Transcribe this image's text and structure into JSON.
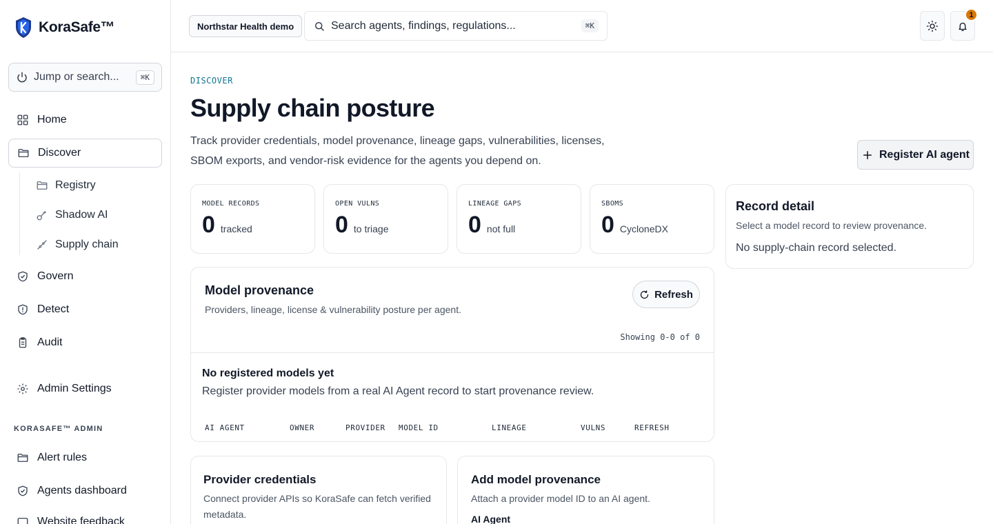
{
  "brand": {
    "name": "KoraSafe™"
  },
  "sidebar": {
    "jump_placeholder": "Jump or search...",
    "jump_shortcut": "⌘K",
    "items": [
      {
        "label": "Home"
      },
      {
        "label": "Discover"
      },
      {
        "label": "Govern"
      },
      {
        "label": "Detect"
      },
      {
        "label": "Audit"
      },
      {
        "label": "Admin Settings"
      }
    ],
    "sub_items": [
      {
        "label": "Registry"
      },
      {
        "label": "Shadow AI"
      },
      {
        "label": "Supply chain"
      }
    ],
    "admin_section": "KORASAFE™ ADMIN",
    "admin_items": [
      {
        "label": "Alert rules"
      },
      {
        "label": "Agents dashboard"
      },
      {
        "label": "Website feedback"
      }
    ]
  },
  "topbar": {
    "org": "Northstar Health demo",
    "search_placeholder": "Search agents, findings, regulations...",
    "search_shortcut": "⌘K",
    "notification_count": "1"
  },
  "page": {
    "eyebrow": "DISCOVER",
    "title": "Supply chain posture",
    "description": "Track provider credentials, model provenance, lineage gaps, vulnerabilities, licenses, SBOM exports, and vendor-risk evidence for the agents you depend on.",
    "primary_action": "Register AI agent"
  },
  "stats": [
    {
      "label": "MODEL RECORDS",
      "value": "0",
      "unit": "tracked"
    },
    {
      "label": "OPEN VULNS",
      "value": "0",
      "unit": "to triage"
    },
    {
      "label": "LINEAGE GAPS",
      "value": "0",
      "unit": "not full"
    },
    {
      "label": "SBOMS",
      "value": "0",
      "unit": "CycloneDX"
    }
  ],
  "detail": {
    "title": "Record detail",
    "subtitle": "Select a model record to review provenance.",
    "empty": "No supply-chain record selected."
  },
  "provenance": {
    "title": "Model provenance",
    "subtitle": "Providers, lineage, license & vulnerability posture per agent.",
    "refresh_label": "Refresh",
    "showing": "Showing 0-0 of 0",
    "empty_title": "No registered models yet",
    "empty_text": "Register provider models from a real AI Agent record to start provenance review.",
    "columns": [
      "AI AGENT",
      "OWNER",
      "PROVIDER",
      "MODEL ID",
      "LINEAGE",
      "VULNS",
      "REFRESH"
    ]
  },
  "credentials": {
    "title": "Provider credentials",
    "subtitle": "Connect provider APIs so KoraSafe can fetch verified metadata."
  },
  "add_provenance": {
    "title": "Add model provenance",
    "subtitle": "Attach a provider model ID to an AI agent.",
    "field_label": "AI Agent"
  },
  "colors": {
    "accent": "#0e7490",
    "badge": "#d97706",
    "border": "#e5e7eb"
  }
}
